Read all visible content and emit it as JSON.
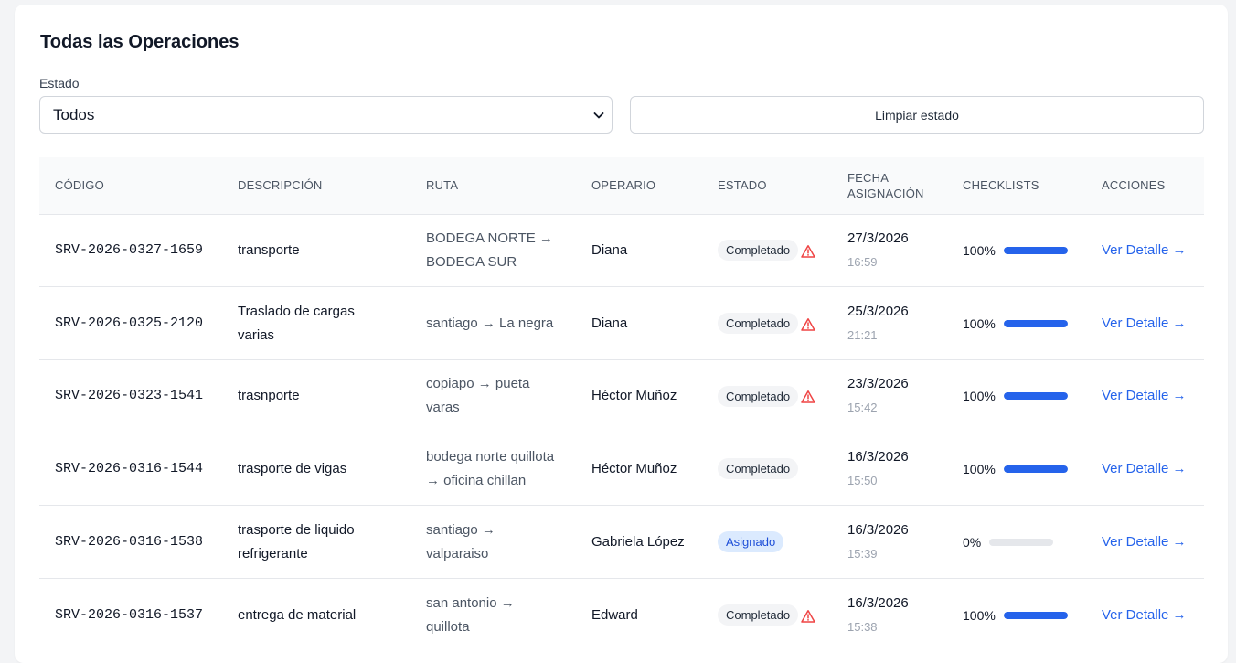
{
  "header": {
    "title": "Todas las Operaciones"
  },
  "filter": {
    "label": "Estado",
    "selected": "Todos",
    "clear_label": "Limpiar estado"
  },
  "table": {
    "columns": [
      "CÓDIGO",
      "DESCRIPCIÓN",
      "RUTA",
      "OPERARIO",
      "ESTADO",
      "FECHA ASIGNACIÓN",
      "CHECKLISTS",
      "ACCIONES"
    ],
    "rows": [
      {
        "code": "SRV-2026-0327-1659",
        "description": "transporte",
        "route": "BODEGA NORTE → BODEGA SUR",
        "operator": "Diana",
        "status": "Completado",
        "status_type": "done",
        "warning": true,
        "date": "27/3/2026",
        "time": "16:59",
        "checklist_label": "100%",
        "checklist": 1.0,
        "action": "Ver Detalle →"
      },
      {
        "code": "SRV-2026-0325-2120",
        "description": "Traslado de cargas varias",
        "route": "santiago → La negra",
        "operator": "Diana",
        "status": "Completado",
        "status_type": "done",
        "warning": true,
        "date": "25/3/2026",
        "time": "21:21",
        "checklist_label": "100%",
        "checklist": 1.0,
        "action": "Ver Detalle →"
      },
      {
        "code": "SRV-2026-0323-1541",
        "description": "trasnporte",
        "route": "copiapo → pueta varas",
        "operator": "Héctor Muñoz",
        "status": "Completado",
        "status_type": "done",
        "warning": true,
        "date": "23/3/2026",
        "time": "15:42",
        "checklist_label": "100%",
        "checklist": 1.0,
        "action": "Ver Detalle →"
      },
      {
        "code": "SRV-2026-0316-1544",
        "description": "trasporte de vigas",
        "route": "bodega norte quillota → oficina chillan",
        "operator": "Héctor Muñoz",
        "status": "Completado",
        "status_type": "done",
        "warning": false,
        "date": "16/3/2026",
        "time": "15:50",
        "checklist_label": "100%",
        "checklist": 1.0,
        "action": "Ver Detalle →"
      },
      {
        "code": "SRV-2026-0316-1538",
        "description": "trasporte de liquido refrigerante",
        "route": "santiago → valparaiso",
        "operator": "Gabriela López",
        "status": "Asignado",
        "status_type": "assigned",
        "warning": false,
        "date": "16/3/2026",
        "time": "15:39",
        "checklist_label": "0%",
        "checklist": 0.0,
        "action": "Ver Detalle →"
      },
      {
        "code": "SRV-2026-0316-1537",
        "description": "entrega de material",
        "route": "san antonio → quillota",
        "operator": "Edward",
        "status": "Completado",
        "status_type": "done",
        "warning": true,
        "date": "16/3/2026",
        "time": "15:38",
        "checklist_label": "100%",
        "checklist": 1.0,
        "action": "Ver Detalle →"
      }
    ]
  },
  "colors": {
    "accent": "#2563eb",
    "warning": "#ef4444",
    "assigned_bg": "#dbeafe"
  },
  "icons": {
    "select": "chevron-down-icon",
    "warning": "warning-triangle-icon"
  }
}
